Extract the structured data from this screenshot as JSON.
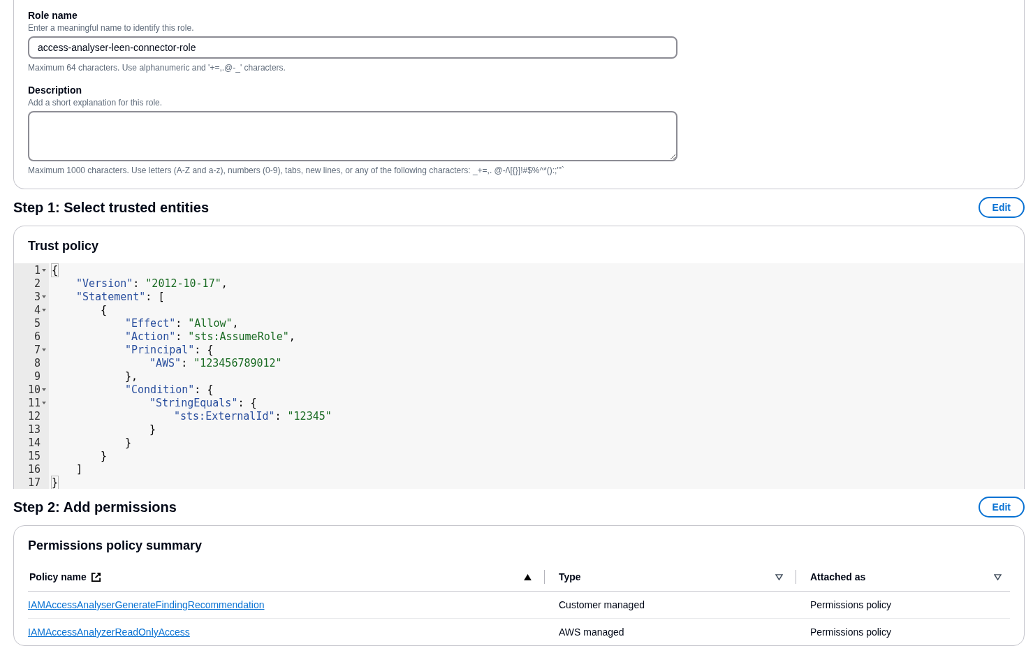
{
  "role_details": {
    "fields": [
      {
        "kind": "input",
        "label": "Role name",
        "hint": "Enter a meaningful name to identify this role.",
        "value": "access-analyser-leen-connector-role",
        "constraint": "Maximum 64 characters. Use alphanumeric and '+=,.@-_' characters."
      },
      {
        "kind": "textarea",
        "label": "Description",
        "hint": "Add a short explanation for this role.",
        "constraint": "Maximum 1000 characters. Use letters (A-Z and a-z), numbers (0-9), tabs, new lines, or any of the following characters: _+=,. @-/\\[{}]!#$%^*():;\"'`"
      }
    ]
  },
  "step1": {
    "title": "Step 1: Select trusted entities",
    "edit_button": "Edit",
    "panel_title": "Trust policy",
    "code_lines": [
      {
        "number": "1",
        "foldable": true,
        "tokens": [
          {
            "kind": "bracket",
            "text": "{"
          }
        ],
        "children": [
          {
            "number": "2",
            "foldable": false,
            "tokens": [
              {
                "kind": "key",
                "text": "\"Version\""
              },
              {
                "kind": "plain",
                "text": ": "
              },
              {
                "kind": "string",
                "text": "\"2012-10-17\""
              },
              {
                "kind": "plain",
                "text": ","
              }
            ]
          },
          {
            "number": "3",
            "foldable": true,
            "tokens": [
              {
                "kind": "key",
                "text": "\"Statement\""
              },
              {
                "kind": "plain",
                "text": ": ["
              }
            ],
            "children": [
              {
                "number": "4",
                "foldable": true,
                "tokens": [
                  {
                    "kind": "plain",
                    "text": "{"
                  }
                ],
                "children": [
                  {
                    "number": "5",
                    "foldable": false,
                    "tokens": [
                      {
                        "kind": "key",
                        "text": "\"Effect\""
                      },
                      {
                        "kind": "plain",
                        "text": ": "
                      },
                      {
                        "kind": "string",
                        "text": "\"Allow\""
                      },
                      {
                        "kind": "plain",
                        "text": ","
                      }
                    ]
                  },
                  {
                    "number": "6",
                    "foldable": false,
                    "tokens": [
                      {
                        "kind": "key",
                        "text": "\"Action\""
                      },
                      {
                        "kind": "plain",
                        "text": ": "
                      },
                      {
                        "kind": "string",
                        "text": "\"sts:AssumeRole\""
                      },
                      {
                        "kind": "plain",
                        "text": ","
                      }
                    ]
                  },
                  {
                    "number": "7",
                    "foldable": true,
                    "tokens": [
                      {
                        "kind": "key",
                        "text": "\"Principal\""
                      },
                      {
                        "kind": "plain",
                        "text": ": {"
                      }
                    ],
                    "children": [
                      {
                        "number": "8",
                        "foldable": false,
                        "tokens": [
                          {
                            "kind": "key",
                            "text": "\"AWS\""
                          },
                          {
                            "kind": "plain",
                            "text": ": "
                          },
                          {
                            "kind": "string",
                            "text": "\"123456789012\""
                          }
                        ]
                      }
                    ]
                  },
                  {
                    "number": "9",
                    "foldable": false,
                    "tokens": [
                      {
                        "kind": "plain",
                        "text": "},"
                      }
                    ]
                  },
                  {
                    "number": "10",
                    "foldable": true,
                    "tokens": [
                      {
                        "kind": "key",
                        "text": "\"Condition\""
                      },
                      {
                        "kind": "plain",
                        "text": ": {"
                      }
                    ],
                    "children": [
                      {
                        "number": "11",
                        "foldable": true,
                        "tokens": [
                          {
                            "kind": "key",
                            "text": "\"StringEquals\""
                          },
                          {
                            "kind": "plain",
                            "text": ": {"
                          }
                        ],
                        "children": [
                          {
                            "number": "12",
                            "foldable": false,
                            "tokens": [
                              {
                                "kind": "key",
                                "text": "\"sts:ExternalId\""
                              },
                              {
                                "kind": "plain",
                                "text": ": "
                              },
                              {
                                "kind": "string",
                                "text": "\"12345\""
                              }
                            ]
                          }
                        ]
                      },
                      {
                        "number": "13",
                        "foldable": false,
                        "tokens": [
                          {
                            "kind": "plain",
                            "text": "}"
                          }
                        ]
                      }
                    ]
                  },
                  {
                    "number": "14",
                    "foldable": false,
                    "tokens": [
                      {
                        "kind": "plain",
                        "text": "}"
                      }
                    ]
                  }
                ]
              },
              {
                "number": "15",
                "foldable": false,
                "tokens": [
                  {
                    "kind": "plain",
                    "text": "}"
                  }
                ]
              }
            ]
          },
          {
            "number": "16",
            "foldable": false,
            "tokens": [
              {
                "kind": "plain",
                "text": "]"
              }
            ]
          }
        ]
      },
      {
        "number": "17",
        "foldable": false,
        "tokens": [
          {
            "kind": "bracket",
            "text": "}"
          }
        ]
      }
    ]
  },
  "step2": {
    "title": "Step 2: Add permissions",
    "edit_button": "Edit",
    "panel_title": "Permissions policy summary",
    "table": {
      "columns": [
        {
          "label": "Policy name",
          "external_link": true,
          "sorted": true
        },
        {
          "label": "Type",
          "external_link": false,
          "sorted": false
        },
        {
          "label": "Attached as",
          "external_link": false,
          "sorted": false
        }
      ],
      "rows": [
        {
          "policy_name": "IAMAccessAnalyserGenerateFindingRecommendation",
          "type": "Customer managed",
          "attached_as": "Permissions policy"
        },
        {
          "policy_name": "IAMAccessAnalyzerReadOnlyAccess",
          "type": "AWS managed",
          "attached_as": "Permissions policy"
        }
      ]
    }
  }
}
